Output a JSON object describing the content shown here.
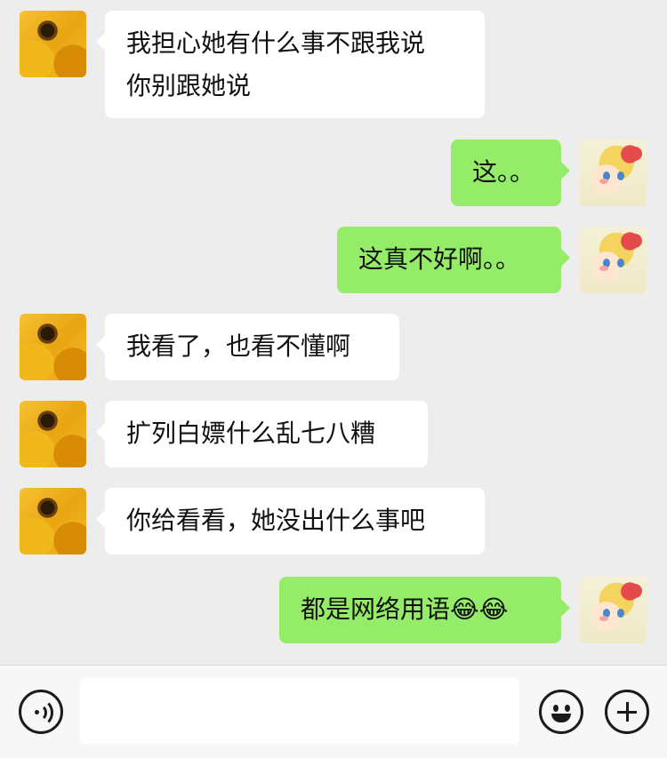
{
  "messages": [
    {
      "side": "left",
      "avatar": "sunflower-avatar",
      "lines": [
        "我担心她有什么事不跟我说",
        "你别跟她说"
      ]
    },
    {
      "side": "right",
      "avatar": "anime-girl-avatar",
      "text": "这。。"
    },
    {
      "side": "right",
      "avatar": "anime-girl-avatar",
      "text": "这真不好啊。。"
    },
    {
      "side": "left",
      "avatar": "sunflower-avatar",
      "text": "我看了，也看不懂啊"
    },
    {
      "side": "left",
      "avatar": "sunflower-avatar",
      "text": "扩列白嫖什么乱七八糟"
    },
    {
      "side": "left",
      "avatar": "sunflower-avatar",
      "text": "你给看看，她没出什么事吧"
    },
    {
      "side": "right",
      "avatar": "anime-girl-avatar",
      "text": "都是网络用语😂😂"
    }
  ],
  "input": {
    "value": ""
  },
  "icons": {
    "voice": "voice-icon",
    "emoji": "emoji-icon",
    "plus": "plus-icon"
  },
  "colors": {
    "background": "#ededed",
    "incoming_bubble": "#ffffff",
    "outgoing_bubble": "#95ec69"
  }
}
